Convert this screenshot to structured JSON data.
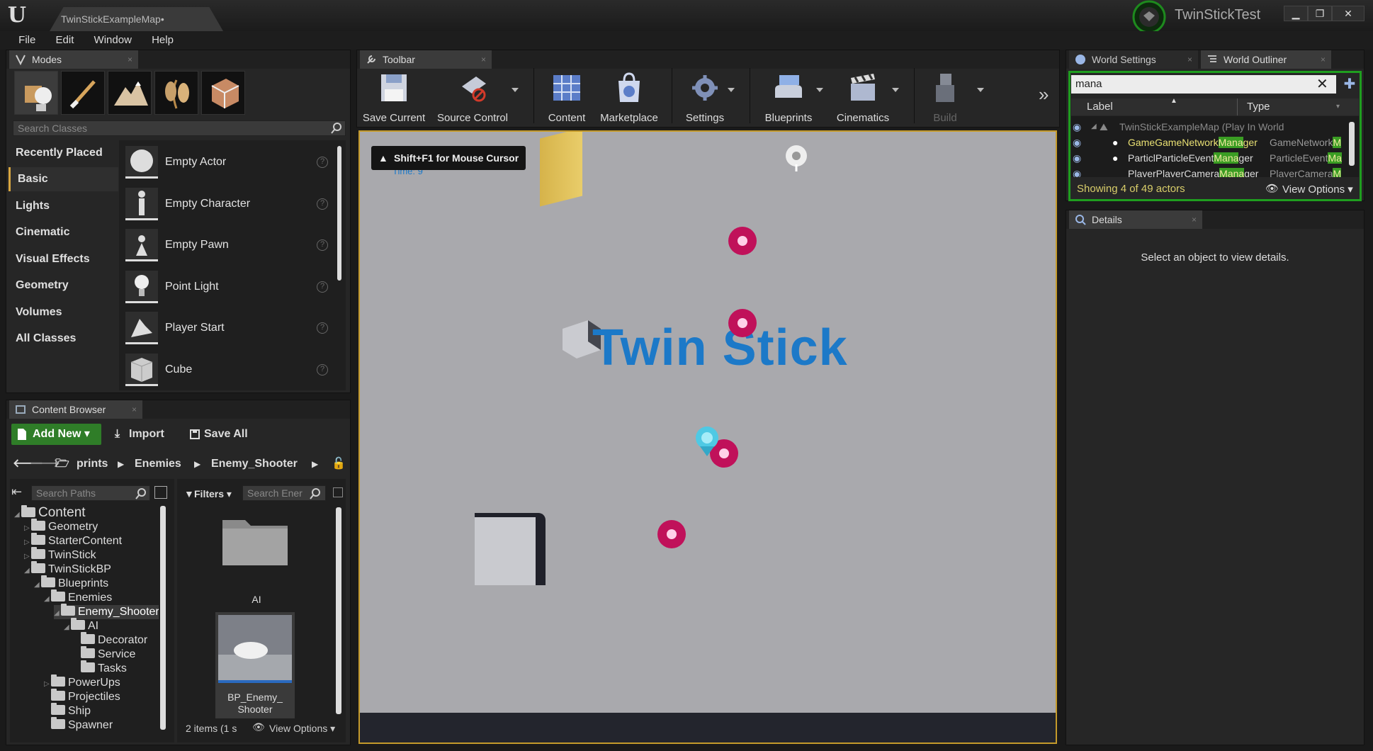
{
  "title_bar": {
    "document_tab": "TwinStickExampleMap•",
    "project_name": "TwinStickTest",
    "window_buttons": [
      "minimize-icon",
      "restore-icon",
      "close-icon"
    ]
  },
  "menu": [
    "File",
    "Edit",
    "Window",
    "Help"
  ],
  "modes": {
    "tab_label": "Modes",
    "search_placeholder": "Search Classes",
    "categories": [
      "Recently Placed",
      "Basic",
      "Lights",
      "Cinematic",
      "Visual Effects",
      "Geometry",
      "Volumes",
      "All Classes"
    ],
    "active_category": "Basic",
    "items": [
      "Empty Actor",
      "Empty Character",
      "Empty Pawn",
      "Point Light",
      "Player Start",
      "Cube"
    ]
  },
  "toolbar": {
    "tab_label": "Toolbar",
    "buttons": [
      "Save Current",
      "Source Control",
      "Content",
      "Marketplace",
      "Settings",
      "Blueprints",
      "Cinematics",
      "Build"
    ]
  },
  "viewport": {
    "hint": "Shift+F1 for Mouse Cursor",
    "time_label": "Time: 9",
    "title_text": "Twin Stick"
  },
  "world_settings": {
    "tab_label": "World Settings"
  },
  "world_outliner": {
    "tab_label": "World Outliner",
    "search_value": "mana",
    "columns": [
      "Label",
      "Type"
    ],
    "rows": [
      {
        "label_pre": "TwinStickExampleMap (Play In World",
        "label_hl": "",
        "label_post": "",
        "type_pre": "",
        "type_hl": ""
      },
      {
        "label_pre": "GameGameNetwork",
        "label_hl": "Mana",
        "label_post": "ger",
        "type_pre": "GameNetwork",
        "type_hl": "M"
      },
      {
        "label_pre": "ParticlParticleEvent",
        "label_hl": "Mana",
        "label_post": "ger",
        "type_pre": "ParticleEvent",
        "type_hl": "Ma"
      },
      {
        "label_pre": "PlayerPlayerCamera",
        "label_hl": "Mana",
        "label_post": "ger",
        "type_pre": "PlayerCamera",
        "type_hl": "M"
      }
    ],
    "status": "Showing 4 of 49 actors",
    "view_options": "View Options"
  },
  "details": {
    "tab_label": "Details",
    "empty_message": "Select an object to view details."
  },
  "content_browser": {
    "tab_label": "Content Browser",
    "add_new": "Add New",
    "import": "Import",
    "save_all": "Save All",
    "breadcrumb": [
      "prints",
      "Enemies",
      "Enemy_Shooter"
    ],
    "search_paths_placeholder": "Search Paths",
    "filters_label": "Filters",
    "search_assets_placeholder": "Search Ener",
    "tree": [
      {
        "label": "Content",
        "depth": 0,
        "caret": "open"
      },
      {
        "label": "Geometry",
        "depth": 1,
        "caret": "closed"
      },
      {
        "label": "StarterContent",
        "depth": 1,
        "caret": "closed"
      },
      {
        "label": "TwinStick",
        "depth": 1,
        "caret": "closed"
      },
      {
        "label": "TwinStickBP",
        "depth": 1,
        "caret": "open"
      },
      {
        "label": "Blueprints",
        "depth": 2,
        "caret": "open"
      },
      {
        "label": "Enemies",
        "depth": 3,
        "caret": "open"
      },
      {
        "label": "Enemy_Shooter",
        "depth": 4,
        "caret": "open"
      },
      {
        "label": "AI",
        "depth": 5,
        "caret": "open"
      },
      {
        "label": "Decorator",
        "depth": 6,
        "caret": "none"
      },
      {
        "label": "Service",
        "depth": 6,
        "caret": "none"
      },
      {
        "label": "Tasks",
        "depth": 6,
        "caret": "none"
      },
      {
        "label": "PowerUps",
        "depth": 3,
        "caret": "closed"
      },
      {
        "label": "Projectiles",
        "depth": 3,
        "caret": "none"
      },
      {
        "label": "Ship",
        "depth": 3,
        "caret": "none"
      },
      {
        "label": "Spawner",
        "depth": 3,
        "caret": "none"
      }
    ],
    "assets": [
      {
        "label": "AI"
      },
      {
        "label": "BP_Enemy_\nShooter"
      }
    ],
    "status": "2 items (1 s",
    "view_options": "View Options"
  },
  "colors": {
    "accent_gold": "#c49a2b",
    "highlight_green": "#3a9d23",
    "add_new_green": "#2f7d28",
    "twin_stick_blue": "#1c79c8",
    "enemy_red": "#c0115a"
  }
}
